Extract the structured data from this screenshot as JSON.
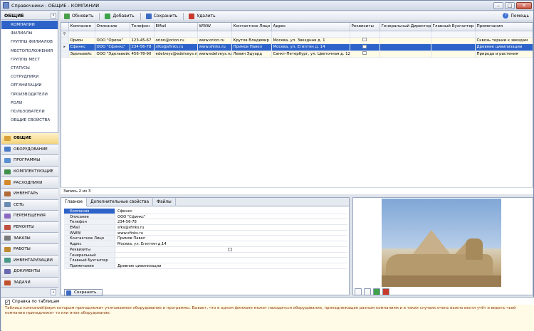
{
  "window": {
    "title": "Справочники - ОБЩИЕ - КОМПАНИИ"
  },
  "left": {
    "header": "ОБЩИЕ",
    "items": [
      "КОМПАНИИ",
      "ФИЛИАЛЫ",
      "ГРУППЫ ФИЛИАЛОВ",
      "МЕСТОПОЛОЖЕНИЯ",
      "ГРУППЫ МЕСТ",
      "СТАТУСЫ",
      "СОТРУДНИКИ",
      "ОРГАНИЗАЦИИ",
      "ПРОИЗВОДИТЕЛИ",
      "РОЛИ",
      "ПОЛЬЗОВАТЕЛИ",
      "ОБЩИЕ СВОЙСТВА"
    ],
    "groups": [
      "ОБЩИЕ",
      "ОБОРУДОВАНИЕ",
      "ПРОГРАММЫ",
      "КОМПЛЕКТУЮЩИЕ",
      "РАСХОДНИКИ",
      "ИНВЕНТАРЬ",
      "СЕТЬ",
      "ПЕРЕМЕЩЕНИЯ",
      "РЕМОНТЫ",
      "ЗАКАЗЫ",
      "РАБОТЫ",
      "ИНВЕНТАРИЗАЦИИ",
      "ДОКУМЕНТЫ",
      "ЗАДАЧИ"
    ],
    "group_colors": [
      "#d9a23a",
      "#4a7cc8",
      "#5a8fd0",
      "#3f8f4a",
      "#d48a2a",
      "#b06a3a",
      "#6a8ab0",
      "#8a6ac0",
      "#c05040",
      "#7a7a7a",
      "#c08a30",
      "#4a9a8a",
      "#6a6ab0",
      "#c0502a"
    ]
  },
  "toolbar": {
    "refresh": "Обновить",
    "add": "Добавить",
    "save": "Сохранить",
    "delete": "Удалить",
    "help": "Помощь"
  },
  "grid": {
    "columns": [
      "Компания",
      "Описание",
      "Телефон",
      "EMail",
      "WWW",
      "Контактное Лицо",
      "Адрес",
      "Реквизиты",
      "Генеральный Директор",
      "Главный Бухгалтер",
      "Примечания"
    ],
    "rows": [
      [
        "Орион",
        "ООО \"Орион\"",
        "123-45-67",
        "orion@orion.ru",
        "www.orion.ru",
        "Крутов Владимир",
        "Москва, ул. Звездная д. 1",
        "",
        "",
        "",
        "Сквозь тернии к звездам"
      ],
      [
        "Сфинкс",
        "ООО \"Сфинкс\"",
        "234-56-78",
        "sfks@sfinks.ru",
        "www.sfinks.ru",
        "Примов Павел",
        "Москва, ул. Египтян д. 14",
        "",
        "",
        "",
        "Древние цивилизации"
      ],
      [
        "Эдельвейс",
        "ООО \"Эдельвейс\"",
        "456-78-90",
        "edelveys@edelveys.ru",
        "www.edelveys.ru",
        "Левин Эдуард",
        "Санкт-Петербург, ул. Цветочная д. 123",
        "",
        "",
        "",
        "Природа и растения"
      ]
    ],
    "status": "Запись 2 из 3"
  },
  "form": {
    "tabs": [
      "Главное",
      "Дополнительные свойства",
      "Файлы"
    ],
    "fields": [
      {
        "k": "Компания",
        "v": "Сфинкс"
      },
      {
        "k": "Описание",
        "v": "ООО \"Сфинкс\""
      },
      {
        "k": "Телефон",
        "v": "234-56-78"
      },
      {
        "k": "EMail",
        "v": "sfks@sfinks.ru"
      },
      {
        "k": "WWW",
        "v": "www.sfinks.ru"
      },
      {
        "k": "Контактное Лицо",
        "v": "Примов Павел"
      },
      {
        "k": "Адрес",
        "v": "Москва, ул. Египтян д.14"
      },
      {
        "k": "Реквизиты",
        "v": ""
      },
      {
        "k": "Генеральный Директор",
        "v": ""
      },
      {
        "k": "Главный Бухгалтер",
        "v": ""
      },
      {
        "k": "Примечания",
        "v": "Древние цивилизации"
      }
    ],
    "save": "Сохранить"
  },
  "helpbar": {
    "checkbox": "Справка по таблицам",
    "text": "Таблица компаний/фирм которым принадлежит учитываемое оборудование и программы. Бывает, что в одном филиале может находиться оборудование, принадлежащее разным компаниям и в таких случаях очень важно вести учёт и видеть чьей компании принадлежит то или иное оборудование."
  }
}
